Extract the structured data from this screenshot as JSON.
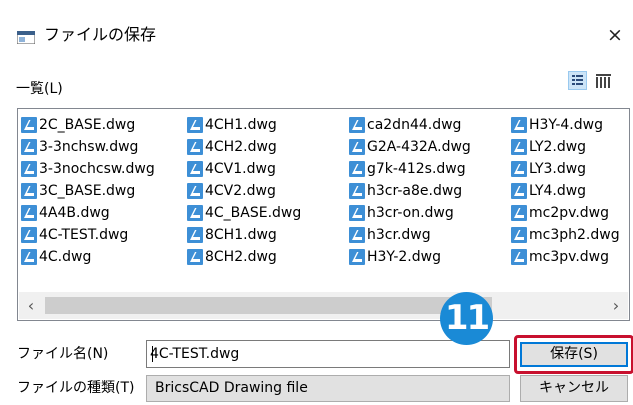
{
  "window": {
    "title": "ファイルの保存",
    "close_label": "×"
  },
  "list": {
    "label": "一覧(L)"
  },
  "files": [
    "2C_BASE.dwg",
    "3-3nchsw.dwg",
    "3-3nochcsw.dwg",
    "3C_BASE.dwg",
    "4A4B.dwg",
    "4C-TEST.dwg",
    "4C.dwg",
    "4CH1.dwg",
    "4CH2.dwg",
    "4CV1.dwg",
    "4CV2.dwg",
    "4C_BASE.dwg",
    "8CH1.dwg",
    "8CH2.dwg",
    "ca2dn44.dwg",
    "G2A-432A.dwg",
    "g7k-412s.dwg",
    "h3cr-a8e.dwg",
    "h3cr-on.dwg",
    "h3cr.dwg",
    "H3Y-2.dwg",
    "H3Y-4.dwg",
    "LY2.dwg",
    "LY3.dwg",
    "LY4.dwg",
    "mc2pv.dwg",
    "mc3ph2.dwg",
    "mc3pv.dwg"
  ],
  "scrollbar": {
    "left_arrow": "‹",
    "right_arrow": "›"
  },
  "form": {
    "filename_label": "ファイル名(N)",
    "filename_value": "4C-TEST.dwg",
    "filetype_label": "ファイルの種類(T)",
    "filetype_value": "BricsCAD Drawing file"
  },
  "buttons": {
    "save": "保存(S)",
    "cancel": "キャンセル"
  },
  "annotation": {
    "step": "11"
  },
  "colors": {
    "accent": "#0078d7",
    "highlight": "#c8102e",
    "badge": "#1a8ad6"
  },
  "icons": {
    "app": "window-icon",
    "file": "bricscad-dwg-icon",
    "list_view": "list-view-icon",
    "detail_view": "details-view-icon"
  }
}
